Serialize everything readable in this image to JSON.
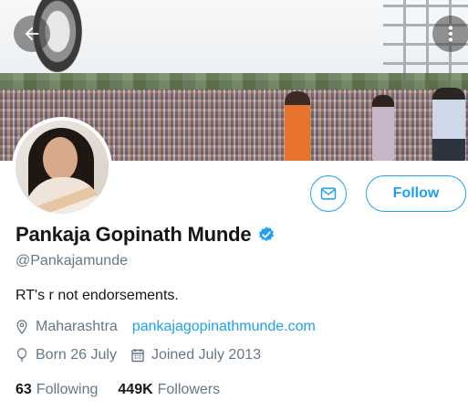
{
  "profile": {
    "name": "Pankaja Gopinath Munde",
    "handle": "@Pankajamunde",
    "bio": "RT's r not endorsements.",
    "location": "Maharashtra",
    "website": "pankajagopinathmunde.com",
    "birthday": "Born 26 July",
    "joined": "Joined July 2013",
    "verified": true
  },
  "stats": {
    "following_count": "63",
    "following_label": "Following",
    "followers_count": "449K",
    "followers_label": "Followers"
  },
  "actions": {
    "follow_label": "Follow"
  },
  "icons": {
    "back": "arrow-left-icon",
    "more": "more-vertical-icon",
    "message": "mail-icon",
    "verified": "verified-badge-icon",
    "location": "location-pin-icon",
    "birthday": "balloon-icon",
    "joined": "calendar-icon"
  },
  "colors": {
    "accent": "#1da1f2",
    "muted_text": "#657786",
    "primary_text": "#14171a"
  }
}
